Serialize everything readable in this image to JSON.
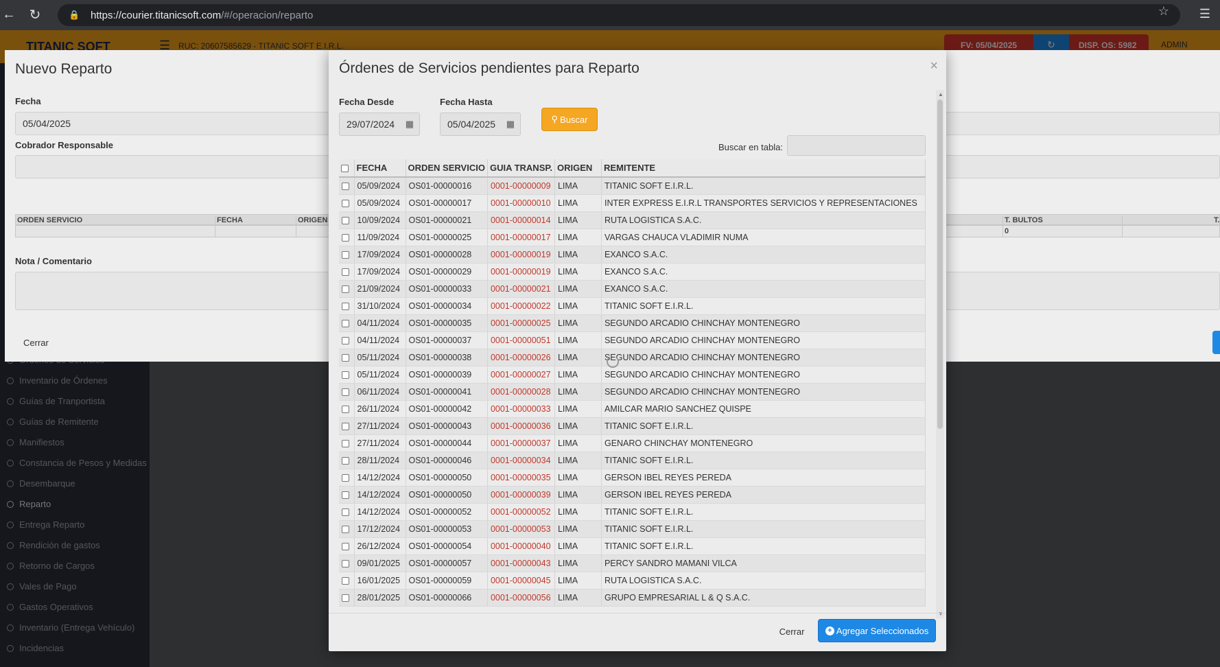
{
  "browser": {
    "url_host": "https://courier.titanicsoft.com",
    "url_path": "/#/operacion/reparto"
  },
  "app": {
    "brand": "TITANIC SOFT",
    "ruc": "RUC: 20607585629 - TITANIC SOFT E.I.R.L.",
    "fv": "FV: 05/04/2025",
    "disp": "DISP. OS: 5982",
    "user": "ADMIN"
  },
  "sidebar": {
    "items": [
      "Órdenes de Servicios",
      "Inventario de Órdenes",
      "Guías de Tranportista",
      "Guías de Remitente",
      "Manifiestos",
      "Constancia de Pesos y Medidas",
      "Desembarque",
      "Reparto",
      "Entrega Reparto",
      "Rendición de gastos",
      "Retorno de Cargos",
      "Vales de Pago",
      "Gastos Operativos",
      "Inventario (Entrega Vehículo)",
      "Incidencias"
    ],
    "active": "Reparto"
  },
  "back_modal": {
    "title": "Nuevo Reparto",
    "fecha_label": "Fecha",
    "fecha_value": "05/04/2025",
    "cobrador_label": "Cobrador Responsable",
    "columns": {
      "orden": "ORDEN SERVICIO",
      "fecha": "FECHA",
      "origen": "ORIGEN",
      "bultos": "T. BULTOS",
      "t": "T."
    },
    "bultos_total": "0",
    "nota_label": "Nota / Comentario",
    "cerrar": "Cerrar"
  },
  "modal": {
    "title": "Órdenes de Servicios pendientes para Reparto",
    "close_symbol": "×",
    "fecha_desde_label": "Fecha Desde",
    "fecha_desde": "29/07/2024",
    "fecha_hasta_label": "Fecha Hasta",
    "fecha_hasta": "05/04/2025",
    "buscar": "Buscar",
    "buscar_tabla_label": "Buscar en tabla:",
    "buscar_tabla_value": "",
    "columns": [
      "FECHA",
      "ORDEN SERVICIO",
      "GUIA TRANSP.",
      "ORIGEN",
      "REMITENTE"
    ],
    "rows": [
      [
        "05/09/2024",
        "OS01-00000016",
        "0001-00000009",
        "LIMA",
        "TITANIC SOFT E.I.R.L."
      ],
      [
        "05/09/2024",
        "OS01-00000017",
        "0001-00000010",
        "LIMA",
        "INTER EXPRESS E.I.R.L TRANSPORTES SERVICIOS Y REPRESENTACIONES"
      ],
      [
        "10/09/2024",
        "OS01-00000021",
        "0001-00000014",
        "LIMA",
        "RUTA LOGISTICA S.A.C."
      ],
      [
        "11/09/2024",
        "OS01-00000025",
        "0001-00000017",
        "LIMA",
        "VARGAS CHAUCA VLADIMIR NUMA"
      ],
      [
        "17/09/2024",
        "OS01-00000028",
        "0001-00000019",
        "LIMA",
        "EXANCO S.A.C."
      ],
      [
        "17/09/2024",
        "OS01-00000029",
        "0001-00000019",
        "LIMA",
        "EXANCO S.A.C."
      ],
      [
        "21/09/2024",
        "OS01-00000033",
        "0001-00000021",
        "LIMA",
        "EXANCO S.A.C."
      ],
      [
        "31/10/2024",
        "OS01-00000034",
        "0001-00000022",
        "LIMA",
        "TITANIC SOFT E.I.R.L."
      ],
      [
        "04/11/2024",
        "OS01-00000035",
        "0001-00000025",
        "LIMA",
        "SEGUNDO ARCADIO CHINCHAY MONTENEGRO"
      ],
      [
        "04/11/2024",
        "OS01-00000037",
        "0001-00000051",
        "LIMA",
        "SEGUNDO ARCADIO CHINCHAY MONTENEGRO"
      ],
      [
        "05/11/2024",
        "OS01-00000038",
        "0001-00000026",
        "LIMA",
        "SEGUNDO ARCADIO CHINCHAY MONTENEGRO"
      ],
      [
        "05/11/2024",
        "OS01-00000039",
        "0001-00000027",
        "LIMA",
        "SEGUNDO ARCADIO CHINCHAY MONTENEGRO"
      ],
      [
        "06/11/2024",
        "OS01-00000041",
        "0001-00000028",
        "LIMA",
        "SEGUNDO ARCADIO CHINCHAY MONTENEGRO"
      ],
      [
        "26/11/2024",
        "OS01-00000042",
        "0001-00000033",
        "LIMA",
        "AMILCAR MARIO SANCHEZ QUISPE"
      ],
      [
        "27/11/2024",
        "OS01-00000043",
        "0001-00000036",
        "LIMA",
        "TITANIC SOFT E.I.R.L."
      ],
      [
        "27/11/2024",
        "OS01-00000044",
        "0001-00000037",
        "LIMA",
        "GENARO CHINCHAY MONTENEGRO"
      ],
      [
        "28/11/2024",
        "OS01-00000046",
        "0001-00000034",
        "LIMA",
        "TITANIC SOFT E.I.R.L."
      ],
      [
        "14/12/2024",
        "OS01-00000050",
        "0001-00000035",
        "LIMA",
        "GERSON IBEL REYES PEREDA"
      ],
      [
        "14/12/2024",
        "OS01-00000050",
        "0001-00000039",
        "LIMA",
        "GERSON IBEL REYES PEREDA"
      ],
      [
        "14/12/2024",
        "OS01-00000052",
        "0001-00000052",
        "LIMA",
        "TITANIC SOFT E.I.R.L."
      ],
      [
        "17/12/2024",
        "OS01-00000053",
        "0001-00000053",
        "LIMA",
        "TITANIC SOFT E.I.R.L."
      ],
      [
        "26/12/2024",
        "OS01-00000054",
        "0001-00000040",
        "LIMA",
        "TITANIC SOFT E.I.R.L."
      ],
      [
        "09/01/2025",
        "OS01-00000057",
        "0001-00000043",
        "LIMA",
        "PERCY SANDRO MAMANI VILCA"
      ],
      [
        "16/01/2025",
        "OS01-00000059",
        "0001-00000045",
        "LIMA",
        "RUTA LOGISTICA S.A.C."
      ],
      [
        "28/01/2025",
        "OS01-00000066",
        "0001-00000056",
        "LIMA",
        "GRUPO EMPRESARIAL L & Q S.A.C."
      ]
    ],
    "cerrar": "Cerrar",
    "agregar": "Agregar Seleccionados"
  }
}
